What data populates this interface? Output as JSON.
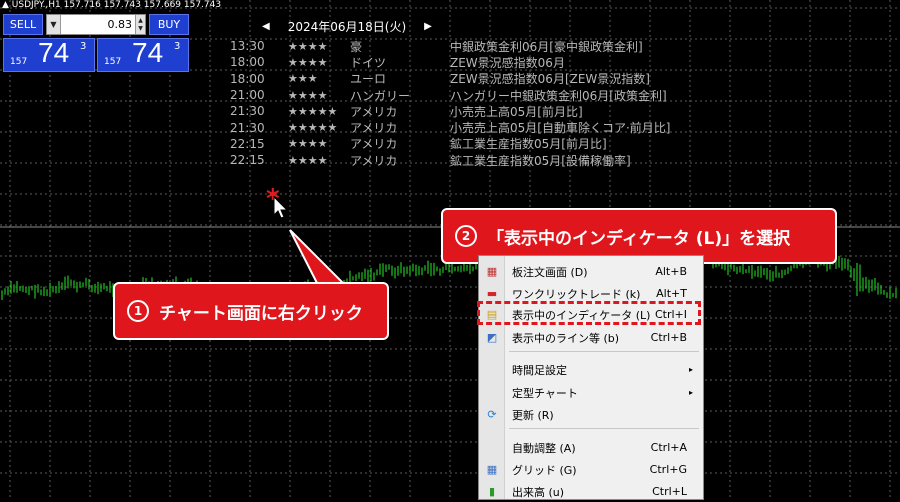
{
  "symbol_info": "▲ USDJPY.,H1  157.716 157.743 157.669 157.743",
  "trade_panel": {
    "sell_label": "SELL",
    "buy_label": "BUY",
    "lot_value": "0.83",
    "sell_prefix": "157",
    "sell_big": "74",
    "sell_sup": "3",
    "buy_prefix": "157",
    "buy_big": "74",
    "buy_sup": "3"
  },
  "calendar": {
    "date": "2024年06月18日(火)",
    "prev_arrow": "◀",
    "next_arrow": "▶",
    "events": [
      {
        "time": "13:30",
        "stars": "★★★★",
        "country": "豪",
        "event": "中銀政策金利06月[豪中銀政策金利]"
      },
      {
        "time": "18:00",
        "stars": "★★★★",
        "country": "ドイツ",
        "event": "ZEW景況感指数06月"
      },
      {
        "time": "18:00",
        "stars": "★★★",
        "country": "ユーロ",
        "event": "ZEW景況感指数06月[ZEW景況指数]"
      },
      {
        "time": "21:00",
        "stars": "★★★★",
        "country": "ハンガリー",
        "event": "ハンガリー中銀政策金利06月[政策金利]"
      },
      {
        "time": "21:30",
        "stars": "★★★★★",
        "country": "アメリカ",
        "event": "小売売上高05月[前月比]"
      },
      {
        "time": "21:30",
        "stars": "★★★★★",
        "country": "アメリカ",
        "event": "小売売上高05月[自動車除くコア·前月比]"
      },
      {
        "time": "22:15",
        "stars": "★★★★",
        "country": "アメリカ",
        "event": "鉱工業生産指数05月[前月比]"
      },
      {
        "time": "22:15",
        "stars": "★★★★",
        "country": "アメリカ",
        "event": "鉱工業生産指数05月[設備稼働率]"
      }
    ]
  },
  "cursor_mark": "*",
  "callouts": {
    "one": {
      "num": "1",
      "text": "チャート画面に右クリック"
    },
    "two": {
      "num": "2",
      "text": "「表示中のインディケータ (L)」を選択"
    }
  },
  "context_menu": {
    "items": [
      {
        "label": "板注文画面 (D)",
        "shortcut": "Alt+B",
        "icon": "order-board-icon"
      },
      {
        "label": "ワンクリックトレード (k)",
        "shortcut": "Alt+T",
        "icon": "one-click-trade-icon"
      },
      {
        "label": "表示中のインディケータ (L)",
        "shortcut": "Ctrl+I",
        "icon": "indicator-list-icon"
      },
      {
        "label": "表示中のライン等 (b)",
        "shortcut": "Ctrl+B",
        "icon": "objects-list-icon"
      },
      {
        "label": "時間足設定",
        "shortcut": "",
        "icon": "",
        "submenu": true
      },
      {
        "label": "定型チャート",
        "shortcut": "",
        "icon": "",
        "submenu": true
      },
      {
        "label": "更新 (R)",
        "shortcut": "",
        "icon": "refresh-icon"
      },
      {
        "label": "自動調整 (A)",
        "shortcut": "Ctrl+A",
        "icon": ""
      },
      {
        "label": "グリッド (G)",
        "shortcut": "Ctrl+G",
        "icon": "grid-icon"
      },
      {
        "label": "出来高 (u)",
        "shortcut": "Ctrl+L",
        "icon": "volume-icon"
      }
    ],
    "submenu_arrow": "▸"
  },
  "colors": {
    "chart_bg": "#000000",
    "grid": "#5a5a5a",
    "candle": "#22c322",
    "callout": "#e0161d",
    "trade_button": "#1f3fd1"
  }
}
